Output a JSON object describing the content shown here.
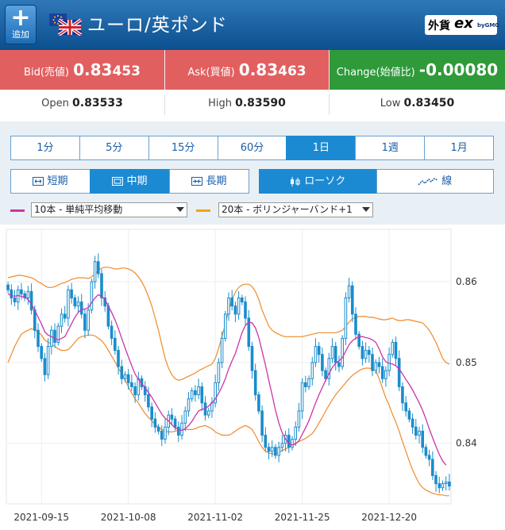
{
  "header": {
    "add_label": "追加",
    "add_icon": "plus-icon",
    "pair_title": "ユーロ/英ポンド",
    "brand_part1": "外貨",
    "brand_part2": "ex",
    "brand_part3": "byGMO",
    "bg_color": "#0b4f8e"
  },
  "prices": {
    "bid_label": "Bid(売値)",
    "bid_value_main": "0.83",
    "bid_value_tail": "453",
    "ask_label": "Ask(買値)",
    "ask_value_main": "0.83",
    "ask_value_tail": "463",
    "change_label": "Change(始値比)",
    "change_value": "-0.00080",
    "bid_color": "#e25f60",
    "change_color": "#2f9a3a"
  },
  "ohl": {
    "open_label": "Open",
    "open_main": "0.83",
    "open_tail": "533",
    "high_label": "High",
    "high_main": "0.83",
    "high_tail": "590",
    "low_label": "Low",
    "low_main": "0.83",
    "low_tail": "450"
  },
  "timeframes": [
    "1分",
    "5分",
    "15分",
    "60分",
    "1日",
    "1週",
    "1月"
  ],
  "timeframe_active": "1日",
  "ranges": [
    {
      "label": "短期",
      "icon": "range-short-icon"
    },
    {
      "label": "中期",
      "icon": "range-mid-icon"
    },
    {
      "label": "長期",
      "icon": "range-long-icon"
    }
  ],
  "range_active": "中期",
  "chart_types": [
    {
      "label": "ローソク",
      "icon": "candlestick-icon"
    },
    {
      "label": "線",
      "icon": "line-chart-icon"
    }
  ],
  "chart_type_active": "ローソク",
  "indicators": {
    "ma_label": "10本 - 単純平均移動",
    "ma_color": "#cc33aa",
    "bb_label": "20本 - ボリンジャーバンド+1",
    "bb_color": "#f4a300"
  },
  "chart_data": {
    "type": "candlestick",
    "x_tick_labels": [
      "2021-09-15",
      "2021-10-08",
      "2021-11-02",
      "2021-11-25",
      "2021-12-20"
    ],
    "y_tick_labels": [
      "0.86",
      "0.85",
      "0.84"
    ],
    "ylim": [
      0.8325,
      0.8665
    ],
    "candle_color": "#1a8ccc",
    "ma_color": "#cc33aa",
    "band_color": "#f08a2a",
    "closes": [
      0.859,
      0.858,
      0.8575,
      0.859,
      0.8585,
      0.858,
      0.8588,
      0.8565,
      0.854,
      0.852,
      0.8505,
      0.8485,
      0.852,
      0.854,
      0.8525,
      0.8545,
      0.856,
      0.8555,
      0.859,
      0.858,
      0.857,
      0.8575,
      0.856,
      0.854,
      0.8565,
      0.86,
      0.8625,
      0.861,
      0.858,
      0.857,
      0.8545,
      0.853,
      0.8515,
      0.8495,
      0.848,
      0.8485,
      0.8475,
      0.847,
      0.846,
      0.848,
      0.847,
      0.846,
      0.8445,
      0.843,
      0.842,
      0.8415,
      0.8405,
      0.842,
      0.8435,
      0.843,
      0.842,
      0.841,
      0.8425,
      0.844,
      0.8455,
      0.8465,
      0.846,
      0.847,
      0.845,
      0.8435,
      0.844,
      0.845,
      0.8475,
      0.85,
      0.853,
      0.856,
      0.858,
      0.857,
      0.856,
      0.858,
      0.8575,
      0.8555,
      0.852,
      0.849,
      0.846,
      0.844,
      0.841,
      0.8395,
      0.839,
      0.8395,
      0.8385,
      0.8395,
      0.84,
      0.841,
      0.8395,
      0.8405,
      0.842,
      0.844,
      0.8475,
      0.847,
      0.848,
      0.85,
      0.852,
      0.851,
      0.849,
      0.848,
      0.8505,
      0.852,
      0.85,
      0.8495,
      0.853,
      0.858,
      0.8595,
      0.856,
      0.8535,
      0.852,
      0.8505,
      0.8515,
      0.851,
      0.849,
      0.85,
      0.8495,
      0.848,
      0.849,
      0.851,
      0.8525,
      0.8505,
      0.847,
      0.845,
      0.844,
      0.843,
      0.842,
      0.841,
      0.8415,
      0.8395,
      0.8385,
      0.838,
      0.836,
      0.835,
      0.8345,
      0.835,
      0.8352,
      0.8347
    ],
    "ma10": [
      0.8585,
      0.8583,
      0.8582,
      0.8583,
      0.8582,
      0.8581,
      0.8578,
      0.8572,
      0.8565,
      0.8556,
      0.8548,
      0.8538,
      0.8534,
      0.8532,
      0.853,
      0.8528,
      0.853,
      0.8532,
      0.854,
      0.8548,
      0.8556,
      0.8562,
      0.8566,
      0.8566,
      0.8568,
      0.8574,
      0.858,
      0.8584,
      0.8582,
      0.8578,
      0.857,
      0.8562,
      0.8553,
      0.8542,
      0.853,
      0.8518,
      0.8507,
      0.8496,
      0.8486,
      0.8479,
      0.8474,
      0.8469,
      0.8463,
      0.8457,
      0.845,
      0.8443,
      0.8436,
      0.8431,
      0.8428,
      0.8423,
      0.8419,
      0.8417,
      0.8416,
      0.8418,
      0.8422,
      0.8427,
      0.8434,
      0.844,
      0.8442,
      0.8443,
      0.8446,
      0.845,
      0.8455,
      0.8462,
      0.847,
      0.848,
      0.8492,
      0.8502,
      0.8511,
      0.8524,
      0.8537,
      0.8546,
      0.855,
      0.8549,
      0.8543,
      0.8531,
      0.8514,
      0.8497,
      0.8478,
      0.846,
      0.8441,
      0.8425,
      0.8413,
      0.8405,
      0.84,
      0.8398,
      0.8399,
      0.8403,
      0.8411,
      0.8419,
      0.8428,
      0.8439,
      0.845,
      0.846,
      0.8469,
      0.8478,
      0.8486,
      0.8494,
      0.8499,
      0.8502,
      0.8506,
      0.8514,
      0.8522,
      0.8527,
      0.853,
      0.8532,
      0.8532,
      0.8531,
      0.853,
      0.8528,
      0.8525,
      0.8517,
      0.8507,
      0.8501,
      0.8499,
      0.8498,
      0.8496,
      0.8492,
      0.8486,
      0.8479,
      0.8473,
      0.8466,
      0.8458,
      0.845,
      0.8441,
      0.843,
      0.8418,
      0.8407,
      0.8396,
      0.8386,
      0.8378,
      0.8373
    ],
    "band_upper": [
      0.8605,
      0.8606,
      0.8607,
      0.8608,
      0.8608,
      0.8607,
      0.8606,
      0.8605,
      0.8603,
      0.86,
      0.8598,
      0.8595,
      0.8593,
      0.8593,
      0.8594,
      0.8596,
      0.8598,
      0.8599,
      0.8601,
      0.8603,
      0.8604,
      0.8605,
      0.8605,
      0.8605,
      0.8604,
      0.8606,
      0.861,
      0.8614,
      0.8617,
      0.8618,
      0.8618,
      0.8617,
      0.8616,
      0.8616,
      0.8617,
      0.8617,
      0.8616,
      0.8614,
      0.8611,
      0.8606,
      0.86,
      0.8592,
      0.8582,
      0.857,
      0.8555,
      0.854,
      0.8522,
      0.8505,
      0.8493,
      0.8485,
      0.848,
      0.8478,
      0.8479,
      0.8481,
      0.8483,
      0.8485,
      0.8487,
      0.849,
      0.8492,
      0.8494,
      0.8496,
      0.8498,
      0.8505,
      0.8518,
      0.8532,
      0.8548,
      0.8565,
      0.8578,
      0.8587,
      0.8593,
      0.8596,
      0.8597,
      0.8597,
      0.8594,
      0.8588,
      0.8578,
      0.8565,
      0.8555,
      0.8545,
      0.854,
      0.8537,
      0.8535,
      0.8533,
      0.8532,
      0.8532,
      0.8532,
      0.8532,
      0.8532,
      0.8532,
      0.8533,
      0.8534,
      0.8535,
      0.8536,
      0.8537,
      0.8537,
      0.8537,
      0.8537,
      0.8537,
      0.8537,
      0.8538,
      0.854,
      0.8545,
      0.855,
      0.8554,
      0.8556,
      0.8557,
      0.8557,
      0.8557,
      0.8556,
      0.8556,
      0.8555,
      0.8554,
      0.8553,
      0.8553,
      0.8554,
      0.8555,
      0.8553,
      0.8552,
      0.8552,
      0.8553,
      0.8553,
      0.8552,
      0.8551,
      0.855,
      0.8549,
      0.8545,
      0.854,
      0.8533,
      0.8525,
      0.8515,
      0.8505,
      0.85,
      0.8498
    ],
    "band_lower": [
      0.85,
      0.851,
      0.852,
      0.8528,
      0.8535,
      0.8538,
      0.854,
      0.8542,
      0.854,
      0.8538,
      0.8534,
      0.8528,
      0.8525,
      0.8523,
      0.852,
      0.8517,
      0.8515,
      0.8515,
      0.8516,
      0.852,
      0.8525,
      0.853,
      0.8532,
      0.8533,
      0.8534,
      0.8534,
      0.8533,
      0.853,
      0.8527,
      0.8522,
      0.8515,
      0.8508,
      0.8501,
      0.8493,
      0.8486,
      0.8478,
      0.847,
      0.8462,
      0.8455,
      0.845,
      0.8443,
      0.8437,
      0.8432,
      0.8428,
      0.8423,
      0.842,
      0.8417,
      0.8415,
      0.8414,
      0.8414,
      0.8415,
      0.8416,
      0.8417,
      0.8417,
      0.8417,
      0.8417,
      0.8418,
      0.842,
      0.8421,
      0.8422,
      0.842,
      0.8418,
      0.8414,
      0.8412,
      0.841,
      0.841,
      0.841,
      0.8412,
      0.8415,
      0.8418,
      0.842,
      0.8422,
      0.842,
      0.8417,
      0.841,
      0.8402,
      0.8395,
      0.839,
      0.8388,
      0.8387,
      0.8387,
      0.8389,
      0.8391,
      0.8393,
      0.8395,
      0.8398,
      0.84,
      0.8402,
      0.8404,
      0.8406,
      0.8409,
      0.8412,
      0.8418,
      0.8425,
      0.8432,
      0.844,
      0.8447,
      0.8454,
      0.846,
      0.8465,
      0.847,
      0.8475,
      0.848,
      0.8484,
      0.8487,
      0.849,
      0.8492,
      0.8493,
      0.8493,
      0.8492,
      0.849,
      0.848,
      0.8468,
      0.8456,
      0.8447,
      0.8436,
      0.8426,
      0.8415,
      0.8402,
      0.839,
      0.8378,
      0.8367,
      0.8358,
      0.835,
      0.8345,
      0.8342,
      0.834,
      0.8338,
      0.8337,
      0.8336,
      0.8336,
      0.8335,
      0.8335
    ]
  }
}
